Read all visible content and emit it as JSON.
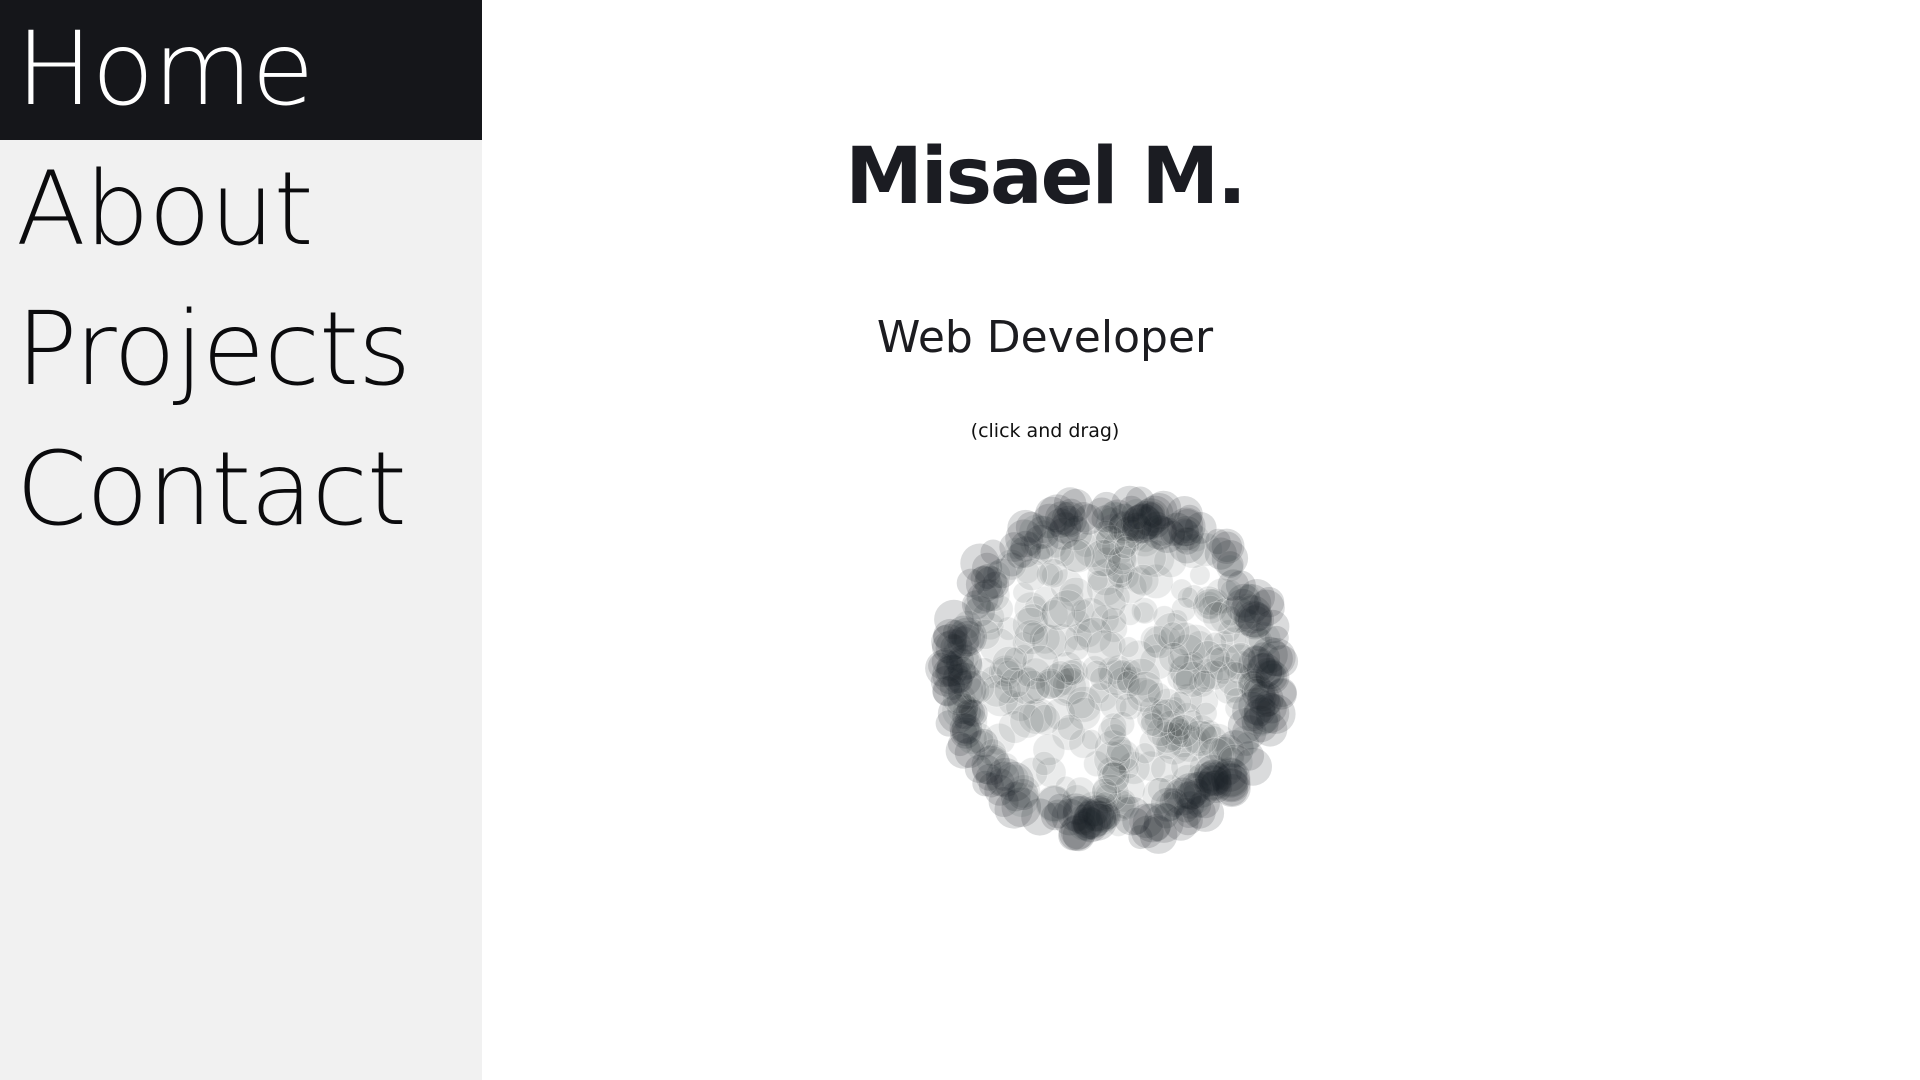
{
  "nav": {
    "items": [
      {
        "label": "Home",
        "active": true
      },
      {
        "label": "About",
        "active": false
      },
      {
        "label": "Projects",
        "active": false
      },
      {
        "label": "Contact",
        "active": false
      }
    ]
  },
  "hero": {
    "name": "Misael M.",
    "role": "Web Developer",
    "hint": "(click and drag)"
  },
  "colors": {
    "sidebar_bg": "#f1f1f1",
    "active_bg": "#15161a",
    "active_text": "#ffffff",
    "text": "#0b0b0d",
    "particle": "#1a1c26"
  }
}
